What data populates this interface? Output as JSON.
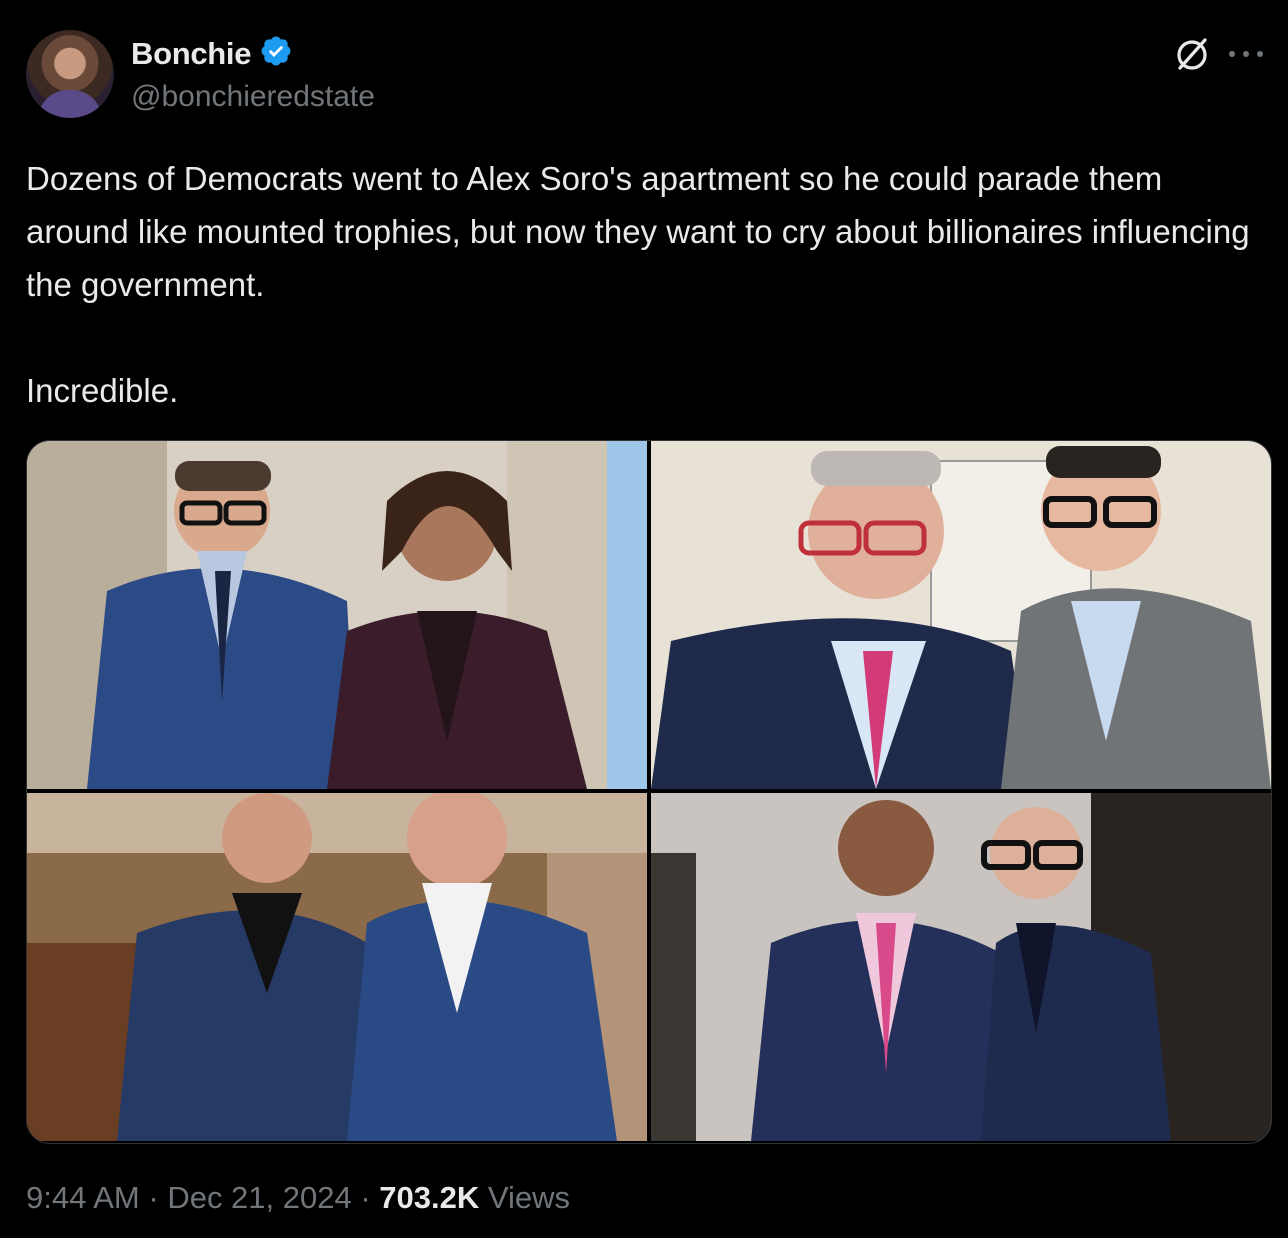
{
  "author": {
    "display_name": "Bonchie",
    "handle": "@bonchieredstate",
    "verified": true
  },
  "tweet": {
    "paragraphs": [
      "Dozens of Democrats went to Alex Soro's apartment so he could parade them around like mounted trophies, but now they want to cry about billionaires influencing the government.",
      "Incredible."
    ]
  },
  "media": {
    "photo_count": 4
  },
  "meta": {
    "time": "9:44 AM",
    "separator": " · ",
    "date": "Dec 21, 2024",
    "views_count": "703.2K",
    "views_label": " Views"
  },
  "colors": {
    "background": "#000000",
    "primary_text": "#e7e9ea",
    "secondary_text": "#71767b",
    "verified_blue": "#1d9bf0",
    "border": "#2f3336"
  },
  "icons": {
    "verified": "verified-badge-icon",
    "grok": "grok-icon",
    "more": "more-options-icon"
  }
}
